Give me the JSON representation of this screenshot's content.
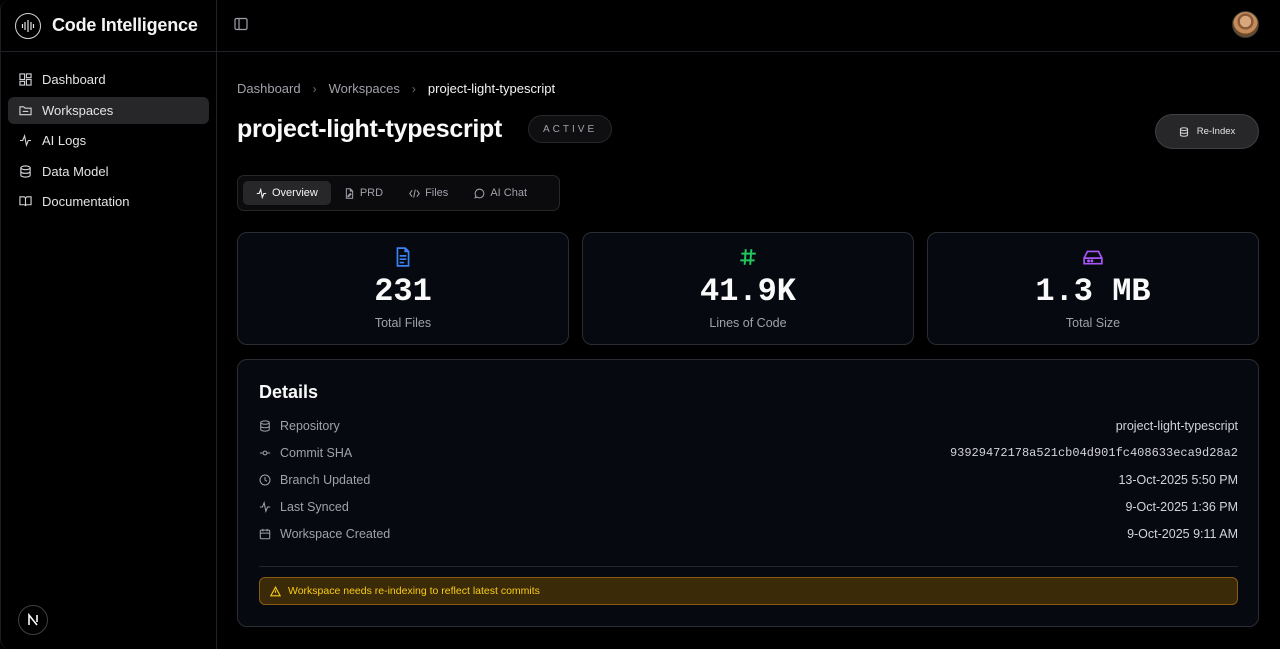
{
  "app": {
    "title": "Code Intelligence",
    "logo_icon": "brain-circuit-icon"
  },
  "sidebar": {
    "items": [
      {
        "label": "Dashboard",
        "icon": "layout-dashboard-icon",
        "active": false
      },
      {
        "label": "Workspaces",
        "icon": "folder-icon",
        "active": true
      },
      {
        "label": "AI Logs",
        "icon": "activity-icon",
        "active": false
      },
      {
        "label": "Data Model",
        "icon": "database-icon",
        "active": false
      },
      {
        "label": "Documentation",
        "icon": "book-open-icon",
        "active": false
      }
    ],
    "footer_badge": "N"
  },
  "breadcrumb": [
    "Dashboard",
    "Workspaces",
    "project-light-typescript"
  ],
  "page": {
    "title": "project-light-typescript",
    "status": "ACTIVE",
    "reindex_label": "Re-Index"
  },
  "tabs": [
    {
      "label": "Overview",
      "icon": "activity-icon",
      "active": true
    },
    {
      "label": "PRD",
      "icon": "file-pen-icon",
      "active": false
    },
    {
      "label": "Files",
      "icon": "code-icon",
      "active": false
    },
    {
      "label": "AI Chat",
      "icon": "message-circle-icon",
      "active": false
    }
  ],
  "stats": [
    {
      "value": "231",
      "label": "Total Files",
      "icon": "file-text-icon",
      "color": "#3b82f6"
    },
    {
      "value": "41.9K",
      "label": "Lines of Code",
      "icon": "hash-icon",
      "color": "#22c55e"
    },
    {
      "value": "1.3 MB",
      "label": "Total Size",
      "icon": "hard-drive-icon",
      "color": "#a855f7"
    }
  ],
  "details": {
    "title": "Details",
    "rows": [
      {
        "label": "Repository",
        "value": "project-light-typescript",
        "icon": "database-icon"
      },
      {
        "label": "Commit SHA",
        "value": "93929472178a521cb04d901fc408633eca9d28a2",
        "icon": "git-commit-icon"
      },
      {
        "label": "Branch Updated",
        "value": "13-Oct-2025 5:50 PM",
        "icon": "clock-icon"
      },
      {
        "label": "Last Synced",
        "value": "9-Oct-2025 1:36 PM",
        "icon": "activity-icon"
      },
      {
        "label": "Workspace Created",
        "value": "9-Oct-2025 9:11 AM",
        "icon": "calendar-icon"
      }
    ],
    "warning": "Workspace needs re-indexing to reflect latest commits"
  },
  "colors": {
    "accent_warning": "#facc15",
    "background": "#000000"
  }
}
